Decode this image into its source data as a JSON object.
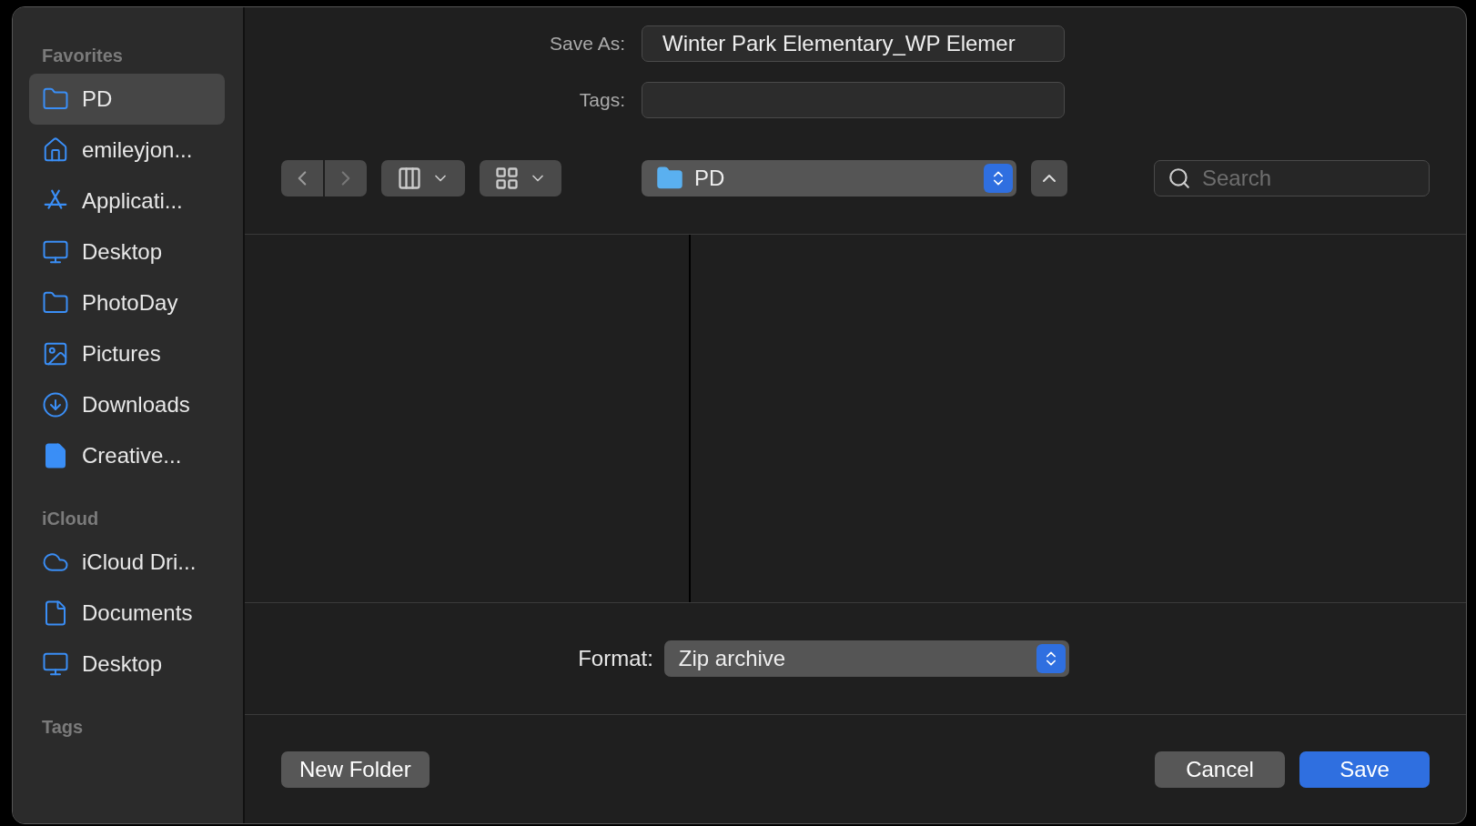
{
  "sidebar": {
    "sections": [
      {
        "title": "Favorites",
        "items": [
          {
            "label": "PD",
            "kind": "folder",
            "selected": true
          },
          {
            "label": "emileyjon...",
            "kind": "home",
            "selected": false
          },
          {
            "label": "Applicati...",
            "kind": "apps",
            "selected": false
          },
          {
            "label": "Desktop",
            "kind": "desktop",
            "selected": false
          },
          {
            "label": "PhotoDay",
            "kind": "folder",
            "selected": false
          },
          {
            "label": "Pictures",
            "kind": "pictures",
            "selected": false
          },
          {
            "label": "Downloads",
            "kind": "downloads",
            "selected": false
          },
          {
            "label": "Creative...",
            "kind": "filled-doc",
            "selected": false
          }
        ]
      },
      {
        "title": "iCloud",
        "items": [
          {
            "label": "iCloud Dri...",
            "kind": "cloud",
            "selected": false
          },
          {
            "label": "Documents",
            "kind": "doc",
            "selected": false
          },
          {
            "label": "Desktop",
            "kind": "desktop",
            "selected": false
          }
        ]
      },
      {
        "title": "Tags"
      }
    ]
  },
  "save_as": {
    "label": "Save As:",
    "value": "Winter Park Elementary_WP Elemer"
  },
  "tags": {
    "label": "Tags:"
  },
  "location": {
    "value": "PD"
  },
  "search": {
    "placeholder": "Search"
  },
  "format": {
    "label": "Format:",
    "value": "Zip archive"
  },
  "buttons": {
    "new_folder": "New Folder",
    "cancel": "Cancel",
    "save": "Save"
  }
}
